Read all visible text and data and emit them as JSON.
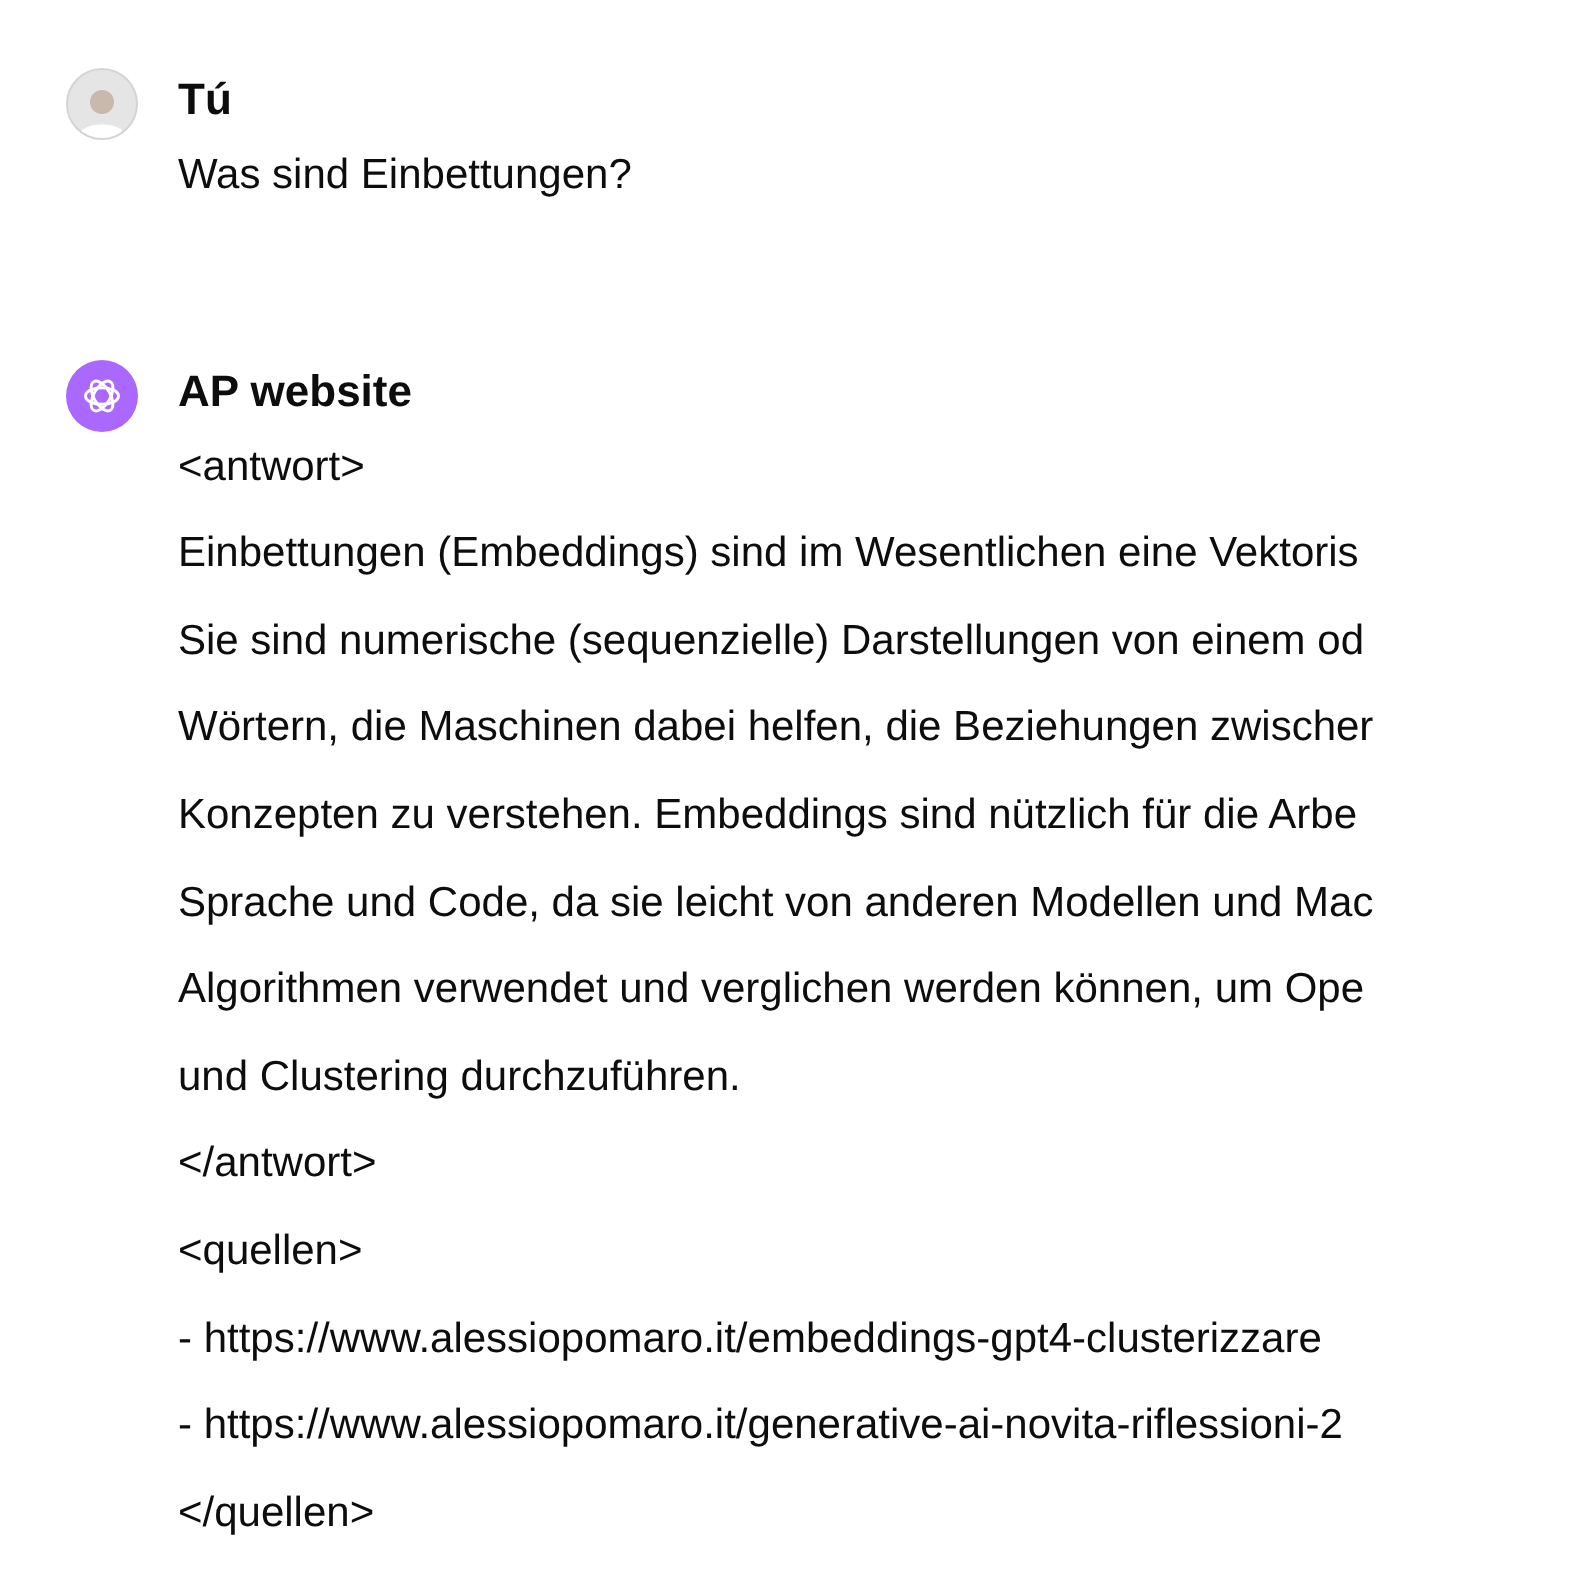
{
  "messages": [
    {
      "kind": "user",
      "author": "Tú",
      "lines": [
        "Was sind Einbettungen?"
      ]
    },
    {
      "kind": "assistant",
      "author": "AP website",
      "lines": [
        "<antwort>",
        "Einbettungen (Embeddings) sind im Wesentlichen eine Vektoris",
        "Sie sind numerische (sequenzielle) Darstellungen von einem od",
        "Wörtern, die Maschinen dabei helfen, die Beziehungen zwischer",
        "Konzepten zu verstehen. Embeddings sind nützlich für die Arbe",
        "Sprache und Code, da sie leicht von anderen Modellen und Mac",
        "Algorithmen verwendet und verglichen werden können, um Ope",
        "und Clustering durchzuführen.",
        "</antwort>",
        "<quellen>",
        "- https://www.alessiopomaro.it/embeddings-gpt4-clusterizzare",
        "- https://www.alessiopomaro.it/generative-ai-novita-riflessioni-2",
        "</quellen>"
      ]
    }
  ]
}
